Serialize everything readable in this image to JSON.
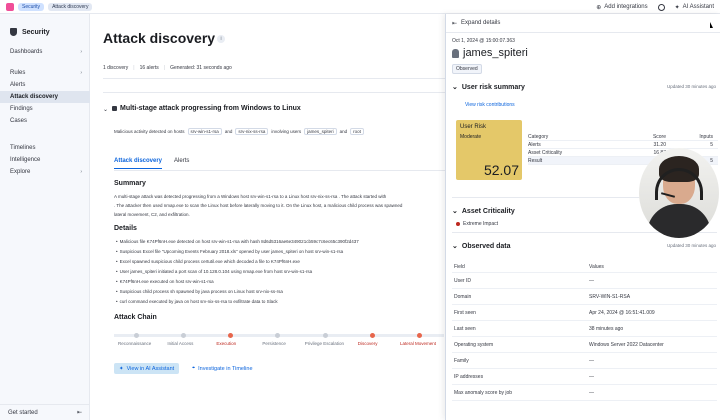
{
  "topbar": {
    "breadcrumbs": [
      "Security",
      "Attack discovery"
    ],
    "add_integrations": "Add integrations",
    "ai_assistant": "AI Assistant"
  },
  "sidebar": {
    "title": "Security",
    "items": [
      {
        "label": "Dashboards",
        "chevron": true
      },
      {
        "label": "Rules",
        "chevron": true
      },
      {
        "label": "Alerts",
        "chevron": false
      },
      {
        "label": "Attack discovery",
        "chevron": false,
        "active": true
      },
      {
        "label": "Findings",
        "chevron": false
      },
      {
        "label": "Cases",
        "chevron": false
      },
      {
        "label": "Timelines",
        "chevron": false
      },
      {
        "label": "Intelligence",
        "chevron": false
      },
      {
        "label": "Explore",
        "chevron": true
      }
    ],
    "get_started": "Get started"
  },
  "main": {
    "title": "Attack discovery",
    "stats": {
      "discoveries": "1 discovery",
      "alerts": "16 alerts",
      "generated": "Generated: 31 seconds ago"
    },
    "card": {
      "title": "Multi-stage attack progressing from Windows to Linux",
      "summary_prefix": "Malicious activity detected on hosts",
      "host1": "srv-win-s1-rsa",
      "and": "and",
      "host2": "srv-nix-ss-rsa",
      "involving": "involving users",
      "user1": "james_spiteri",
      "user2": "root"
    },
    "tabs": [
      "Attack discovery",
      "Alerts"
    ],
    "summary_heading": "Summary",
    "summary_lines": [
      "A multi-stage attack was detected progressing from a Windows host srv-win-s1-rsa to a Linux host srv-nix-ss-rsa . The attack started with",
      ". The attacker then used nmap.exe to scan the Linux host before laterally moving to it. On the Linux host, a malicious child process was spawned",
      "lateral movement, C2, and exfiltration."
    ],
    "details_heading": "Details",
    "details": [
      "Malicious file K74Pf6nH.exe detected on host srv-win-s1-rsa with hash 8d6d5316ae6e349021cb59c7c6ec65c390f2d437",
      "Suspicious Excel file \"Upcoming Events February 2018.xls\" opened by user james_spiteri on host srv-win-s1-rsa",
      "Excel spawned suspicious child process certutil.exe which decoded a file to K74Pf6nH.exe",
      "User james_spiteri initiated a port scan of 10.128.0.104 using nmap.exe from host srv-win-s1-rsa",
      "K74Pf6nH.exe executed on host srv-win-s1-rsa",
      "Suspicious child process sh spawned by java process on Linux host srv-nix-ss-rsa",
      "curl command executed by java on host srv-nix-ss-rsa to exfiltrate data to Slack"
    ],
    "chain_heading": "Attack Chain",
    "chain": [
      {
        "label": "Reconnaissance",
        "hit": false
      },
      {
        "label": "Initial Access",
        "hit": false
      },
      {
        "label": "Execution",
        "hit": true
      },
      {
        "label": "Persistence",
        "hit": false
      },
      {
        "label": "Privilege Escalation",
        "hit": false
      },
      {
        "label": "Discovery",
        "hit": true
      },
      {
        "label": "Lateral Movement",
        "hit": true
      }
    ],
    "view_ai": "View in AI Assistant",
    "investigate": "Investigate in Timeline"
  },
  "flyout": {
    "expand": "Expand details",
    "timestamp": "Oct 1, 2024 @ 15:00:07.363",
    "username": "james_spiteri",
    "observed": "Observed",
    "risk_section": "User risk summary",
    "risk_updated": "Updated 30 minutes ago",
    "view_risk": "View risk contributions",
    "risk_label": "User Risk",
    "risk_level": "Moderate",
    "risk_value": "52.07",
    "risk_table": {
      "headers": [
        "Category",
        "Score",
        "Inputs"
      ],
      "rows": [
        [
          "Alerts",
          "31.20",
          "5"
        ],
        [
          "Asset Criticality",
          "16.87",
          ""
        ],
        [
          "Result",
          "52.07",
          "5"
        ]
      ]
    },
    "criticality_section": "Asset Criticality",
    "criticality_value": "Extreme Impact",
    "observed_section": "Observed data",
    "observed_updated": "Updated 30 minutes ago",
    "observed_table": {
      "headers": [
        "Field",
        "Values"
      ],
      "rows": [
        [
          "User ID",
          "—"
        ],
        [
          "Domain",
          "SRV-WIN-S1-RSA"
        ],
        [
          "First seen",
          "Apr 24, 2024 @ 16:51:41.009"
        ],
        [
          "Last seen",
          "38 minutes ago"
        ],
        [
          "Operating system",
          "Windows Server 2022 Datacenter"
        ],
        [
          "Family",
          "—"
        ],
        [
          "IP addresses",
          "—"
        ],
        [
          "Max anomaly score by job",
          "—"
        ]
      ]
    }
  }
}
